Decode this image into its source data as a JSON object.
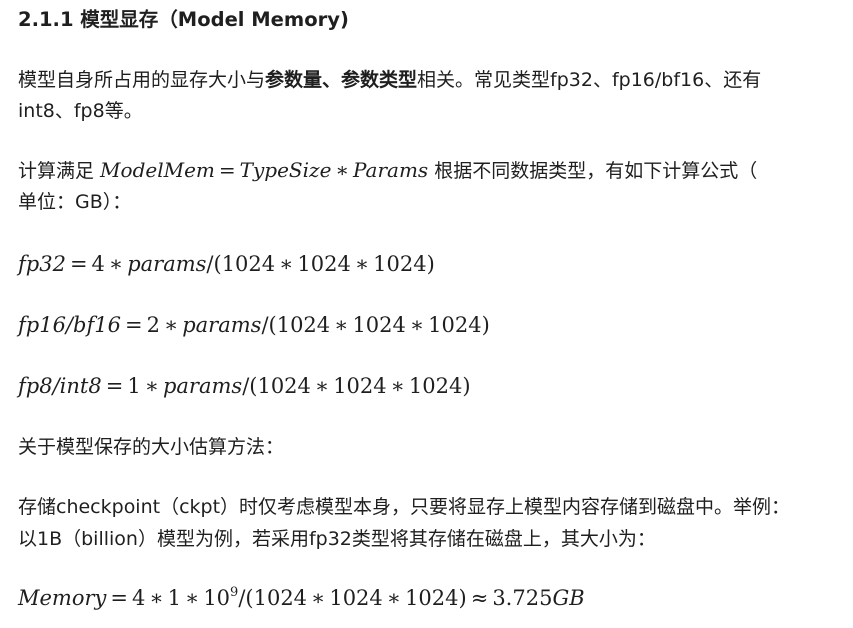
{
  "heading": "2.1.1 模型显存（Model Memory)",
  "intro": {
    "part1": "模型自身所占用的显存大小与",
    "bold": "参数量、参数类型",
    "part2": "相关。常见类型fp32、fp16/bf16、还有",
    "line2": "int8、fp8等。"
  },
  "calc": {
    "prefix": "计算满足 ",
    "formula": {
      "lhs": "ModelMem",
      "eq": "=",
      "a": "TypeSize",
      "op": "∗",
      "b": "Params"
    },
    "suffix": " 根据不同数据类型，有如下计算公式（",
    "line2": "单位：GB）："
  },
  "formulas": [
    {
      "lhs": "fp32",
      "eq": "=",
      "coef": "4",
      "op": "∗",
      "var": "params",
      "div": "/(1024",
      "m1": "∗",
      "n1": "1024",
      "m2": "∗",
      "n2": "1024)"
    },
    {
      "lhs": "fp16/bf16",
      "eq": "=",
      "coef": "2",
      "op": "∗",
      "var": "params",
      "div": "/(1024",
      "m1": "∗",
      "n1": "1024",
      "m2": "∗",
      "n2": "1024)"
    },
    {
      "lhs": "fp8/int8",
      "eq": "=",
      "coef": "1",
      "op": "∗",
      "var": "params",
      "div": "/(1024",
      "m1": "∗",
      "n1": "1024",
      "m2": "∗",
      "n2": "1024)"
    }
  ],
  "save_heading": "关于模型保存的大小估算方法：",
  "storage": {
    "line1": "存储checkpoint（ckpt）时仅考虑模型本身，只要将显存上模型内容存储到磁盘中。举例：",
    "line2": "以1B（billion）模型为例，若采用fp32类型将其存储在磁盘上，其大小为："
  },
  "memory_formula": {
    "lhs": "Memory",
    "eq": "=",
    "t1": "4",
    "op1": "∗",
    "t2": "1",
    "op2": "∗",
    "base": "10",
    "exp": "9",
    "div": "/(1024",
    "m1": "∗",
    "n1": "1024",
    "m2": "∗",
    "n2": "1024)",
    "approx": "≈",
    "result": "3.725",
    "unit": "GB"
  }
}
